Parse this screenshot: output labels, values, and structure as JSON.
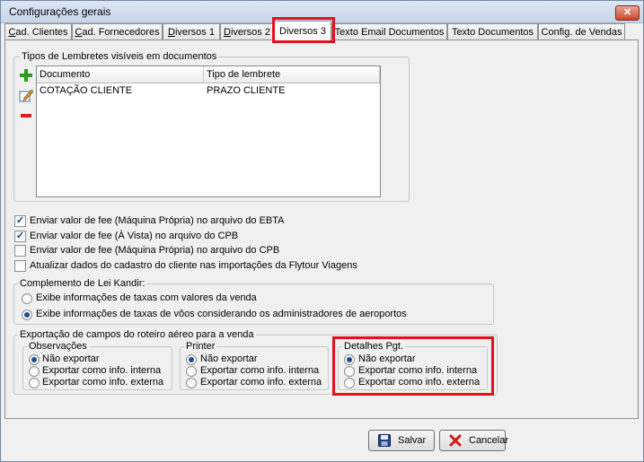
{
  "window": {
    "title": "Configurações gerais",
    "close_glyph": "✕"
  },
  "tabs": [
    {
      "label": "Cad. Clientes",
      "accel": "C",
      "rest": "ad. Clientes"
    },
    {
      "label": "Cad. Fornecedores",
      "accel": "C",
      "rest": "ad. Fornecedores"
    },
    {
      "label": "Diversos 1",
      "accel": "D",
      "rest": "iversos 1"
    },
    {
      "label": "Diversos 2",
      "accel": "D",
      "rest": "iversos 2"
    },
    {
      "label": "Diversos 3",
      "accel": "",
      "rest": "Diversos 3"
    },
    {
      "label": "Texto Email Documentos",
      "accel": "",
      "rest": "Texto Email Documentos"
    },
    {
      "label": "Texto Documentos",
      "accel": "",
      "rest": "Texto Documentos"
    },
    {
      "label": "Config. de Vendas",
      "accel": "",
      "rest": "Config. de Vendas"
    }
  ],
  "reminders": {
    "title": "Tipos de Lembretes visíveis em documentos",
    "columns": [
      "Documento",
      "Tipo de lembrete"
    ],
    "rows": [
      [
        "COTAÇÃO CLIENTE",
        "PRAZO CLIENTE"
      ]
    ],
    "icons": [
      "add-icon",
      "edit-icon",
      "remove-icon"
    ]
  },
  "checkboxes": [
    {
      "label": "Enviar valor de fee (Máquina Própria) no arquivo do EBTA",
      "checked": true
    },
    {
      "label": "Enviar valor de fee (À Vista) no arquivo do CPB",
      "checked": true
    },
    {
      "label": "Enviar valor de fee (Máquina Própria) no arquivo do CPB",
      "checked": false
    },
    {
      "label": "Atualizar dados do cadastro do cliente nas importações da Flytour Viagens",
      "checked": false
    }
  ],
  "lei_kandir": {
    "title": "Complemento de Lei Kandir:",
    "options": [
      {
        "label": "Exibe informações de taxas com valores da venda",
        "selected": false
      },
      {
        "label": "Exibe informações de taxas de vôos considerando os administradores de aeroportos",
        "selected": true
      }
    ]
  },
  "export": {
    "title": "Exportação de campos do roteiro aéreo para a venda",
    "groups": [
      {
        "title": "Observações",
        "options": [
          "Não exportar",
          "Exportar como info. interna",
          "Exportar como info. externa"
        ],
        "selected": 0
      },
      {
        "title": "Printer",
        "options": [
          "Não exportar",
          "Exportar como info. interna",
          "Exportar como info. externa"
        ],
        "selected": 0
      },
      {
        "title": "Detalhes Pgt.",
        "options": [
          "Não exportar",
          "Exportar como info. interna",
          "Exportar como info. externa"
        ],
        "selected": 0
      }
    ]
  },
  "buttons": {
    "save": "Salvar",
    "cancel": "Cancelar"
  },
  "colors": {
    "highlight": "#e8101a",
    "radio_dot": "#1d4e94"
  }
}
